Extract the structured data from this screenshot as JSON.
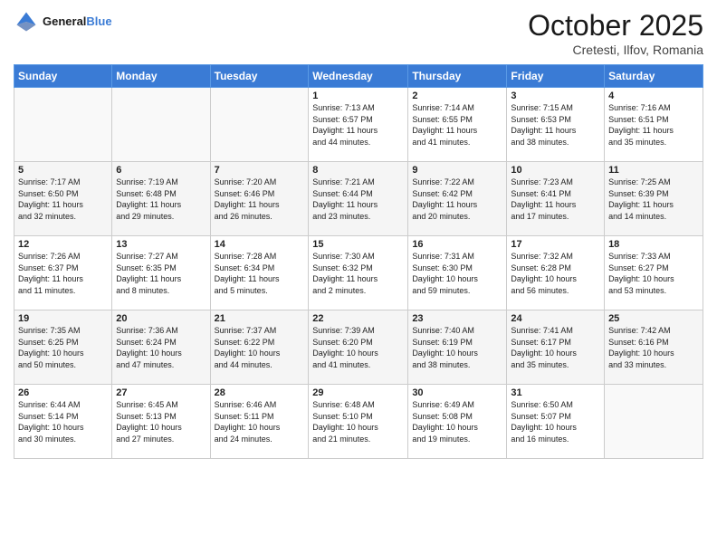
{
  "header": {
    "logo_text_general": "General",
    "logo_text_blue": "Blue",
    "month": "October 2025",
    "location": "Cretesti, Ilfov, Romania"
  },
  "days_of_week": [
    "Sunday",
    "Monday",
    "Tuesday",
    "Wednesday",
    "Thursday",
    "Friday",
    "Saturday"
  ],
  "weeks": [
    [
      {
        "num": "",
        "info": ""
      },
      {
        "num": "",
        "info": ""
      },
      {
        "num": "",
        "info": ""
      },
      {
        "num": "1",
        "info": "Sunrise: 7:13 AM\nSunset: 6:57 PM\nDaylight: 11 hours\nand 44 minutes."
      },
      {
        "num": "2",
        "info": "Sunrise: 7:14 AM\nSunset: 6:55 PM\nDaylight: 11 hours\nand 41 minutes."
      },
      {
        "num": "3",
        "info": "Sunrise: 7:15 AM\nSunset: 6:53 PM\nDaylight: 11 hours\nand 38 minutes."
      },
      {
        "num": "4",
        "info": "Sunrise: 7:16 AM\nSunset: 6:51 PM\nDaylight: 11 hours\nand 35 minutes."
      }
    ],
    [
      {
        "num": "5",
        "info": "Sunrise: 7:17 AM\nSunset: 6:50 PM\nDaylight: 11 hours\nand 32 minutes."
      },
      {
        "num": "6",
        "info": "Sunrise: 7:19 AM\nSunset: 6:48 PM\nDaylight: 11 hours\nand 29 minutes."
      },
      {
        "num": "7",
        "info": "Sunrise: 7:20 AM\nSunset: 6:46 PM\nDaylight: 11 hours\nand 26 minutes."
      },
      {
        "num": "8",
        "info": "Sunrise: 7:21 AM\nSunset: 6:44 PM\nDaylight: 11 hours\nand 23 minutes."
      },
      {
        "num": "9",
        "info": "Sunrise: 7:22 AM\nSunset: 6:42 PM\nDaylight: 11 hours\nand 20 minutes."
      },
      {
        "num": "10",
        "info": "Sunrise: 7:23 AM\nSunset: 6:41 PM\nDaylight: 11 hours\nand 17 minutes."
      },
      {
        "num": "11",
        "info": "Sunrise: 7:25 AM\nSunset: 6:39 PM\nDaylight: 11 hours\nand 14 minutes."
      }
    ],
    [
      {
        "num": "12",
        "info": "Sunrise: 7:26 AM\nSunset: 6:37 PM\nDaylight: 11 hours\nand 11 minutes."
      },
      {
        "num": "13",
        "info": "Sunrise: 7:27 AM\nSunset: 6:35 PM\nDaylight: 11 hours\nand 8 minutes."
      },
      {
        "num": "14",
        "info": "Sunrise: 7:28 AM\nSunset: 6:34 PM\nDaylight: 11 hours\nand 5 minutes."
      },
      {
        "num": "15",
        "info": "Sunrise: 7:30 AM\nSunset: 6:32 PM\nDaylight: 11 hours\nand 2 minutes."
      },
      {
        "num": "16",
        "info": "Sunrise: 7:31 AM\nSunset: 6:30 PM\nDaylight: 10 hours\nand 59 minutes."
      },
      {
        "num": "17",
        "info": "Sunrise: 7:32 AM\nSunset: 6:28 PM\nDaylight: 10 hours\nand 56 minutes."
      },
      {
        "num": "18",
        "info": "Sunrise: 7:33 AM\nSunset: 6:27 PM\nDaylight: 10 hours\nand 53 minutes."
      }
    ],
    [
      {
        "num": "19",
        "info": "Sunrise: 7:35 AM\nSunset: 6:25 PM\nDaylight: 10 hours\nand 50 minutes."
      },
      {
        "num": "20",
        "info": "Sunrise: 7:36 AM\nSunset: 6:24 PM\nDaylight: 10 hours\nand 47 minutes."
      },
      {
        "num": "21",
        "info": "Sunrise: 7:37 AM\nSunset: 6:22 PM\nDaylight: 10 hours\nand 44 minutes."
      },
      {
        "num": "22",
        "info": "Sunrise: 7:39 AM\nSunset: 6:20 PM\nDaylight: 10 hours\nand 41 minutes."
      },
      {
        "num": "23",
        "info": "Sunrise: 7:40 AM\nSunset: 6:19 PM\nDaylight: 10 hours\nand 38 minutes."
      },
      {
        "num": "24",
        "info": "Sunrise: 7:41 AM\nSunset: 6:17 PM\nDaylight: 10 hours\nand 35 minutes."
      },
      {
        "num": "25",
        "info": "Sunrise: 7:42 AM\nSunset: 6:16 PM\nDaylight: 10 hours\nand 33 minutes."
      }
    ],
    [
      {
        "num": "26",
        "info": "Sunrise: 6:44 AM\nSunset: 5:14 PM\nDaylight: 10 hours\nand 30 minutes."
      },
      {
        "num": "27",
        "info": "Sunrise: 6:45 AM\nSunset: 5:13 PM\nDaylight: 10 hours\nand 27 minutes."
      },
      {
        "num": "28",
        "info": "Sunrise: 6:46 AM\nSunset: 5:11 PM\nDaylight: 10 hours\nand 24 minutes."
      },
      {
        "num": "29",
        "info": "Sunrise: 6:48 AM\nSunset: 5:10 PM\nDaylight: 10 hours\nand 21 minutes."
      },
      {
        "num": "30",
        "info": "Sunrise: 6:49 AM\nSunset: 5:08 PM\nDaylight: 10 hours\nand 19 minutes."
      },
      {
        "num": "31",
        "info": "Sunrise: 6:50 AM\nSunset: 5:07 PM\nDaylight: 10 hours\nand 16 minutes."
      },
      {
        "num": "",
        "info": ""
      }
    ]
  ]
}
